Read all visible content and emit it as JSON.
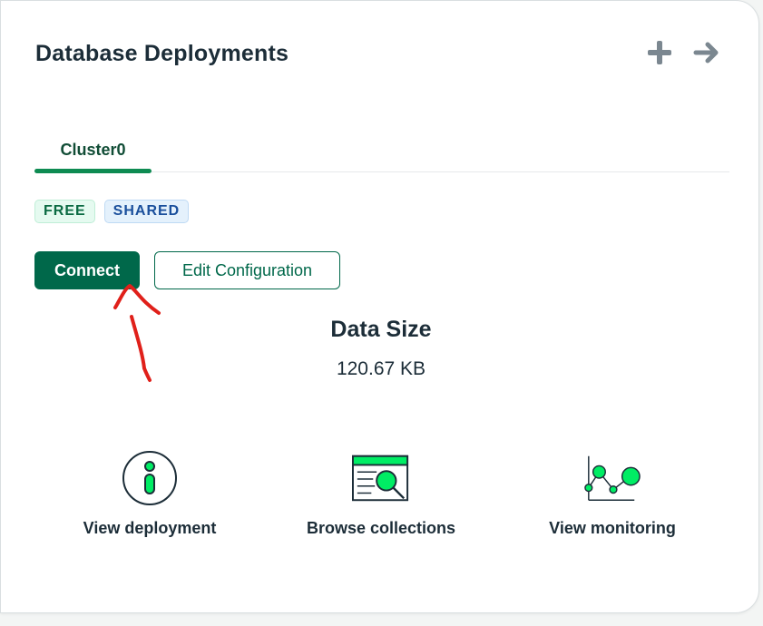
{
  "card": {
    "title": "Database Deployments",
    "icons": {
      "add": "plus-icon",
      "navigate": "arrow-right-icon"
    }
  },
  "tabs": [
    {
      "label": "Cluster0",
      "active": true
    }
  ],
  "badges": {
    "free": "FREE",
    "shared": "SHARED"
  },
  "buttons": {
    "connect": "Connect",
    "edit_configuration": "Edit Configuration"
  },
  "data_size": {
    "label": "Data Size",
    "value": "120.67 KB"
  },
  "actions": [
    {
      "label": "View deployment",
      "icon": "info-icon"
    },
    {
      "label": "Browse collections",
      "icon": "browse-collections-icon"
    },
    {
      "label": "View monitoring",
      "icon": "monitoring-chart-icon"
    }
  ],
  "colors": {
    "brand_green": "#00684a",
    "accent_green": "#00ed64",
    "text_dark": "#1c2d38",
    "annotation_red": "#e0201a"
  }
}
